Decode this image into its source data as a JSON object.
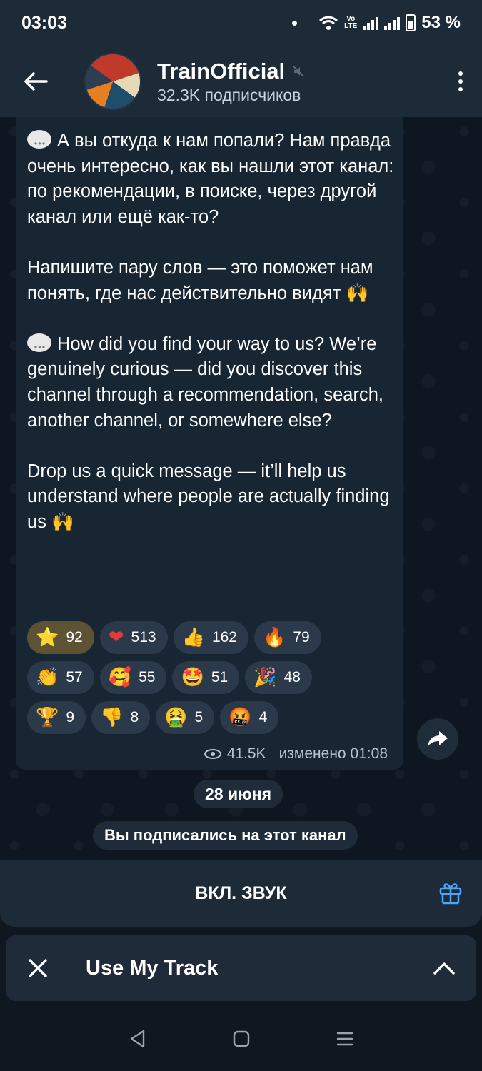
{
  "status": {
    "time": "03:03",
    "volte": "Vo\nLTE",
    "battery": "53 %"
  },
  "header": {
    "channel_name": "TrainOfficial",
    "subscribers": "32.3K подписчиков",
    "muted_icon": "mute-icon"
  },
  "message": {
    "ru_p1": "А вы откуда к нам попали? Нам правда очень интересно, как вы нашли этот канал: по рекомендации, в поиске, через другой канал или ещё как-то?",
    "ru_p2": "Напишите пару слов — это поможет нам понять, где нас действительно видят",
    "en_p1": "How did you find your way to us? We’re genuinely curious — did you discover this channel through a recommendation, search, another channel, or somewhere else?",
    "en_p2": "Drop us a quick message — it’ll help us understand where people are actually finding us",
    "raised_hands": "🙌",
    "views": "41.5K",
    "edited": "изменено 01:08"
  },
  "reactions": [
    [
      {
        "icon": "⭐",
        "count": "92",
        "active": true
      },
      {
        "icon": "❤",
        "count": "513"
      },
      {
        "icon": "👍",
        "count": "162"
      },
      {
        "icon": "🔥",
        "count": "79"
      }
    ],
    [
      {
        "icon": "👏",
        "count": "57"
      },
      {
        "icon": "🥰",
        "count": "55"
      },
      {
        "icon": "🤩",
        "count": "51"
      },
      {
        "icon": "🎉",
        "count": "48"
      }
    ],
    [
      {
        "icon": "🏆",
        "count": "9"
      },
      {
        "icon": "👎",
        "count": "8"
      },
      {
        "icon": "🤮",
        "count": "5"
      },
      {
        "icon": "🤬",
        "count": "4"
      }
    ]
  ],
  "date_label": "28 июня",
  "service_message": "Вы подписались на этот канал",
  "sound_button": "ВКЛ. ЗВУК",
  "player": {
    "title": "Use My Track"
  },
  "colors": {
    "accent": "#4ea4f6",
    "bubble": "#182533",
    "bar": "#1d2a38"
  }
}
